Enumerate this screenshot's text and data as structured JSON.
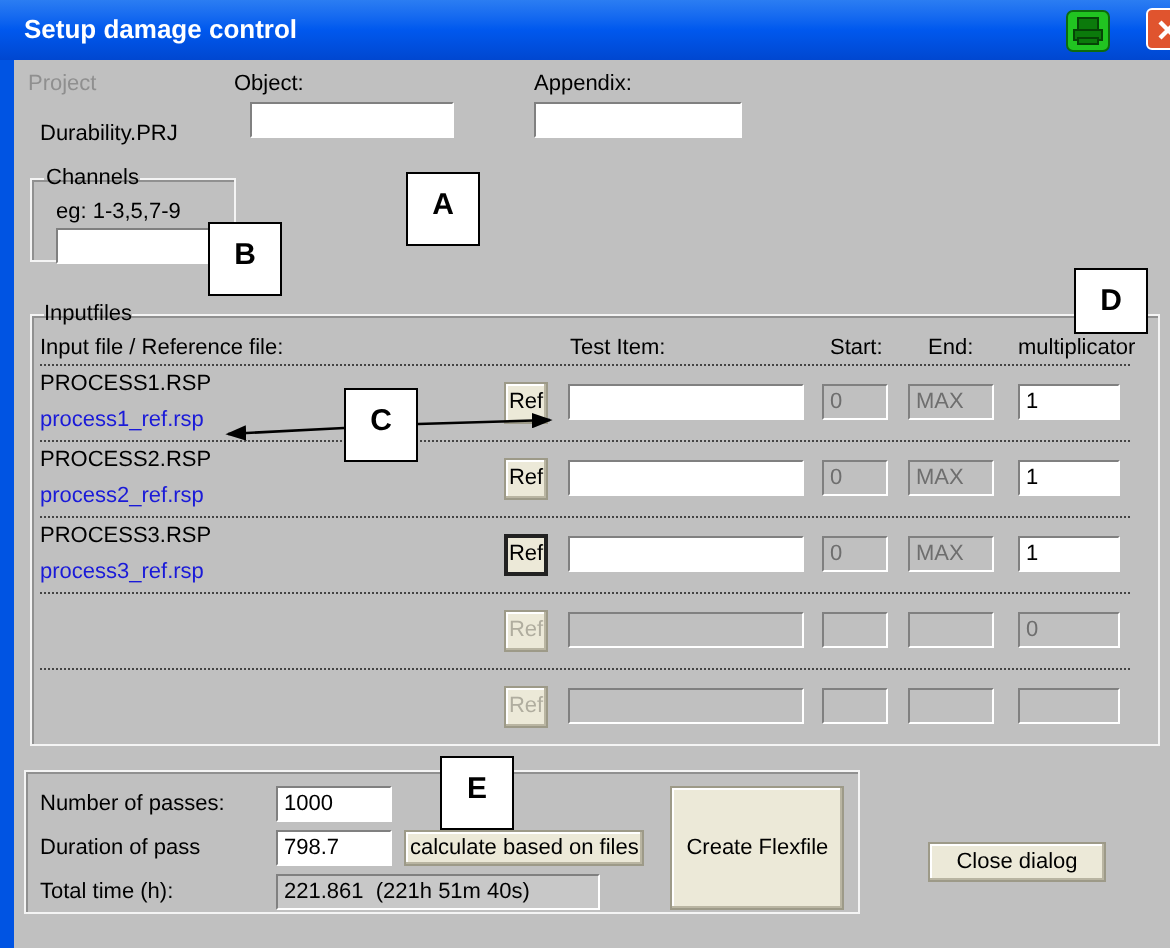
{
  "window": {
    "title": "Setup damage control"
  },
  "project": {
    "label": "Project",
    "value": "Durability.PRJ"
  },
  "object": {
    "label": "Object:"
  },
  "appendix": {
    "label": "Appendix:"
  },
  "channels": {
    "title": "Channels",
    "hint": "eg: 1-3,5,7-9"
  },
  "inputfiles": {
    "title": "Inputfiles",
    "columns": [
      "Input file / Reference file:",
      "Test Item:",
      "Start:",
      "End:",
      "multiplicator"
    ],
    "rows": [
      {
        "input_file": "PROCESS1.RSP",
        "reference_file": "process1_ref.rsp",
        "ref_button": {
          "label": "Ref",
          "disabled": false,
          "focused": false
        },
        "test_item": {
          "disabled": false
        },
        "start": {
          "value": "0",
          "disabled": true
        },
        "end": {
          "value": "MAX",
          "disabled": true
        },
        "multiplicator": {
          "value": "1",
          "disabled": false
        }
      },
      {
        "input_file": "PROCESS2.RSP",
        "reference_file": "process2_ref.rsp",
        "ref_button": {
          "label": "Ref",
          "disabled": false,
          "focused": false
        },
        "test_item": {
          "disabled": false
        },
        "start": {
          "value": "0",
          "disabled": true
        },
        "end": {
          "value": "MAX",
          "disabled": true
        },
        "multiplicator": {
          "value": "1",
          "disabled": false
        }
      },
      {
        "input_file": "PROCESS3.RSP",
        "reference_file": "process3_ref.rsp",
        "ref_button": {
          "label": "Ref",
          "disabled": false,
          "focused": true
        },
        "test_item": {
          "disabled": false
        },
        "start": {
          "value": "0",
          "disabled": true
        },
        "end": {
          "value": "MAX",
          "disabled": true
        },
        "multiplicator": {
          "value": "1",
          "disabled": false
        }
      },
      {
        "ref_button": {
          "label": "Ref",
          "disabled": true,
          "focused": false
        },
        "test_item": {
          "disabled": true
        },
        "start": {
          "disabled": true
        },
        "end": {
          "disabled": true
        },
        "multiplicator": {
          "value": "0",
          "disabled": true
        }
      },
      {
        "ref_button": {
          "label": "Ref",
          "disabled": true,
          "focused": false
        },
        "test_item": {
          "disabled": true
        },
        "start": {
          "disabled": true
        },
        "end": {
          "disabled": true
        },
        "multiplicator": {
          "disabled": true
        }
      }
    ]
  },
  "passes": {
    "label": "Number of passes:",
    "value": "1000"
  },
  "duration": {
    "label": "Duration of pass",
    "value": "798.7",
    "button": "calculate based on files"
  },
  "total": {
    "label": "Total time (h):",
    "value": "221.861  (221h 51m 40s)"
  },
  "buttons": [
    "Create Flexfile",
    "Close dialog"
  ],
  "annotations": [
    "A",
    "B",
    "C",
    "D",
    "E"
  ]
}
